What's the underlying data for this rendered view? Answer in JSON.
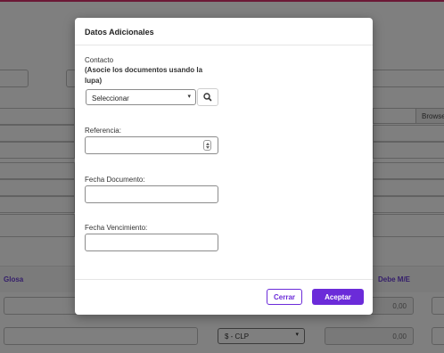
{
  "background": {
    "browse_label": "Browse",
    "glosa_label": "Glosa",
    "debe_label": "Debe M/E",
    "amount_1": "0,00",
    "amount_2": "0,00",
    "currency_select": "$ - CLP",
    "accent_color": "#6b2bd9"
  },
  "modal": {
    "title": "Datos Adicionales",
    "contacto_label": "Contacto",
    "contacto_hint": "(Asocie los documentos usando la lupa)",
    "contacto_select_value": "Seleccionar",
    "search_icon": "magnifier-icon",
    "referencia_label": "Referencia:",
    "referencia_value": "",
    "fecha_documento_label": "Fecha Documento:",
    "fecha_documento_value": "",
    "fecha_vencimiento_label": "Fecha Vencimiento:",
    "fecha_vencimiento_value": "",
    "cerrar_label": "Cerrar",
    "aceptar_label": "Aceptar"
  }
}
